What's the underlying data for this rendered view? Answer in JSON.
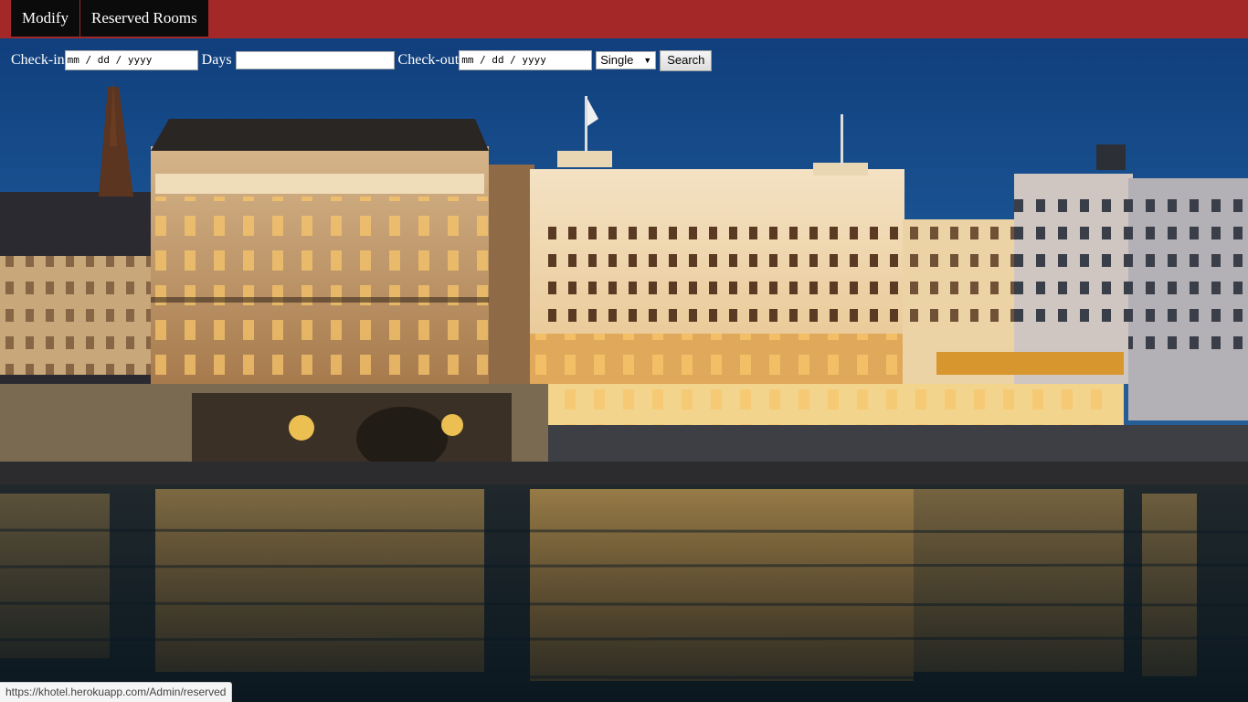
{
  "nav": {
    "items": [
      {
        "label": "Modify"
      },
      {
        "label": "Reserved Rooms"
      }
    ]
  },
  "search": {
    "checkin_label": "Check-in",
    "checkin_placeholder": "mm / dd / yyyy",
    "days_label": "Days",
    "days_value": "",
    "checkout_label": "Check-out",
    "checkout_placeholder": "mm / dd / yyyy",
    "room_type_selected": "Single",
    "search_label": "Search"
  },
  "status_url": "https://khotel.herokuapp.com/Admin/reserved",
  "colors": {
    "navbar": "#a42828",
    "nav_item_bg": "#0b0b0b",
    "sky": "#1a4a86",
    "water": "#0c1a24"
  }
}
